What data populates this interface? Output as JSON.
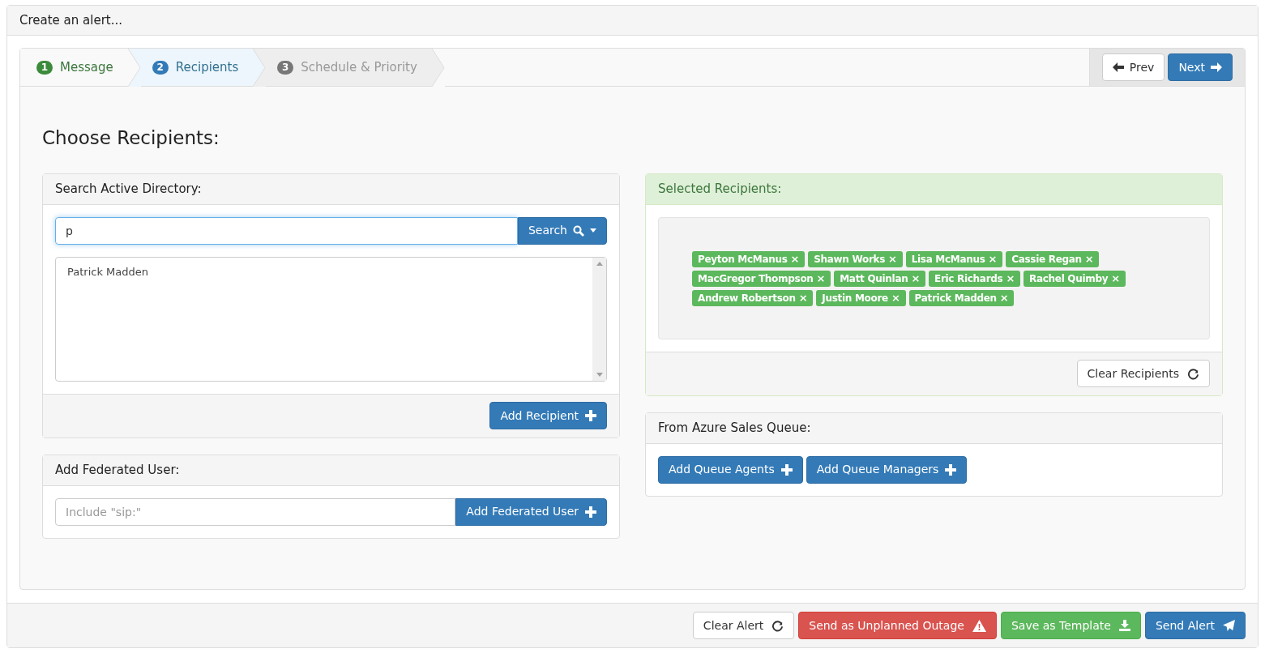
{
  "panel_title": "Create an alert...",
  "steps": [
    {
      "number": "1",
      "label": "Message",
      "completed": true,
      "selected": false
    },
    {
      "number": "2",
      "label": "Recipients",
      "completed": false,
      "selected": true
    },
    {
      "number": "3",
      "label": "Schedule & Priority",
      "completed": false,
      "selected": false
    }
  ],
  "nav_buttons": [
    {
      "label": "Prev",
      "kind": "default"
    },
    {
      "label": "Next",
      "kind": "primary"
    }
  ],
  "heading": "Choose Recipients:",
  "search_panel": {
    "title": "Search Active Directory:",
    "value": "p",
    "search_button": "Search",
    "results": [
      "Patrick Madden"
    ],
    "add_button": "Add Recipient"
  },
  "federated_panel": {
    "title": "Add Federated User:",
    "placeholder": "Include \"sip:\"",
    "add_button": "Add Federated User"
  },
  "selected_panel": {
    "title": "Selected Recipients:",
    "clear_button": "Clear Recipients",
    "recipients": [
      {
        "name": "Peyton McManus",
        "remove": "×"
      },
      {
        "name": "Shawn Works",
        "remove": "×"
      },
      {
        "name": "Lisa McManus",
        "remove": "×"
      },
      {
        "name": "Cassie Regan",
        "remove": "×"
      },
      {
        "name": "MacGregor Thompson",
        "remove": "×"
      },
      {
        "name": "Matt Quinlan",
        "remove": "×"
      },
      {
        "name": "Eric Richards",
        "remove": "×"
      },
      {
        "name": "Rachel Quimby",
        "remove": "×"
      },
      {
        "name": "Andrew Robertson",
        "remove": "×"
      },
      {
        "name": "Justin Moore",
        "remove": "×"
      },
      {
        "name": "Patrick Madden",
        "remove": "×"
      }
    ]
  },
  "queue_panel": {
    "title": "From Azure Sales Queue:",
    "buttons": [
      "Add Queue Agents",
      "Add Queue Managers"
    ]
  },
  "footer_buttons": [
    {
      "label": "Clear Alert",
      "kind": "default"
    },
    {
      "label": "Send as Unplanned Outage",
      "kind": "danger"
    },
    {
      "label": "Save as Template",
      "kind": "success"
    },
    {
      "label": "Send Alert",
      "kind": "primary"
    }
  ]
}
